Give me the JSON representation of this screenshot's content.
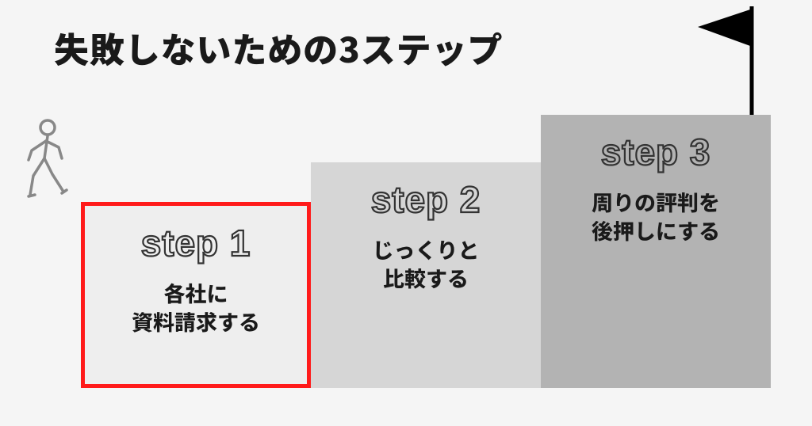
{
  "title": "失敗しないための3ステップ",
  "icons": {
    "walker": "walking-person-icon",
    "flag": "goal-flag-icon"
  },
  "steps": [
    {
      "label": "step 1",
      "desc": "各社に\n資料請求する",
      "highlight": true
    },
    {
      "label": "step 2",
      "desc": "じっくりと\n比較する",
      "highlight": false
    },
    {
      "label": "step 3",
      "desc": "周りの評判を\n後押しにする",
      "highlight": false
    }
  ],
  "colors": {
    "highlight_border": "#ff1a1a",
    "step1_bg": "#eeeeee",
    "step2_bg": "#d6d6d6",
    "step3_bg": "#b3b3b3",
    "text": "#1a1a1a",
    "outline": "#333333"
  }
}
